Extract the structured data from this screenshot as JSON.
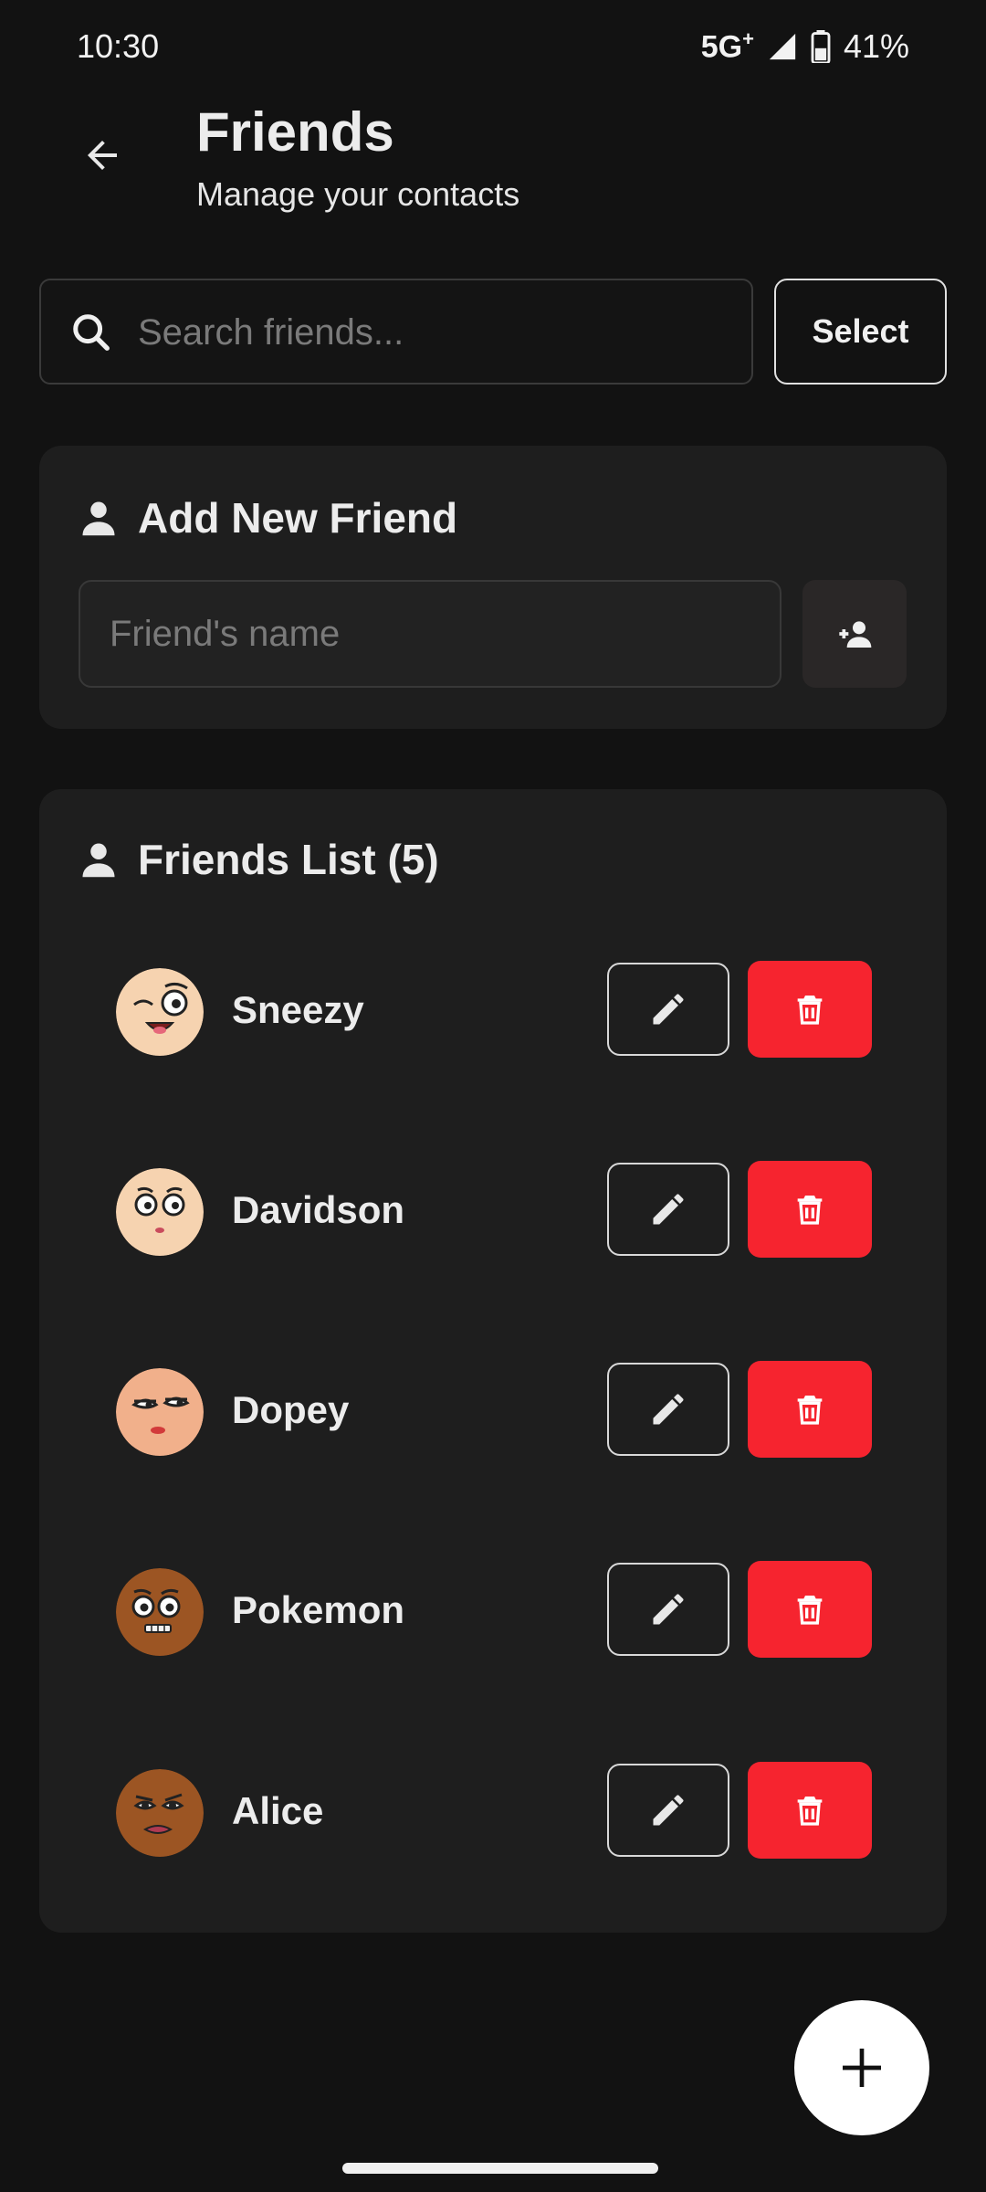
{
  "status_bar": {
    "time": "10:30",
    "network": "5G",
    "network_sup": "+",
    "battery": "41%"
  },
  "header": {
    "title": "Friends",
    "subtitle": "Manage your contacts"
  },
  "search": {
    "placeholder": "Search friends...",
    "select_label": "Select"
  },
  "add_friend": {
    "title": "Add New Friend",
    "name_placeholder": "Friend's name"
  },
  "friends_list": {
    "title": "Friends List (5)",
    "friends": [
      {
        "name": "Sneezy",
        "skin": "#f6d3b0"
      },
      {
        "name": "Davidson",
        "skin": "#f6d3b0"
      },
      {
        "name": "Dopey",
        "skin": "#f1b08b"
      },
      {
        "name": "Pokemon",
        "skin": "#9c5523"
      },
      {
        "name": "Alice",
        "skin": "#9c5523"
      }
    ]
  },
  "icons": {
    "back": "arrow-left-icon",
    "search": "search-icon",
    "person": "person-icon",
    "add_person": "person-add-icon",
    "edit": "pencil-icon",
    "delete": "trash-icon",
    "fab": "plus-icon"
  },
  "colors": {
    "background": "#121212",
    "card": "#1e1e1e",
    "delete": "#f6242f",
    "fab": "#ffffff"
  }
}
